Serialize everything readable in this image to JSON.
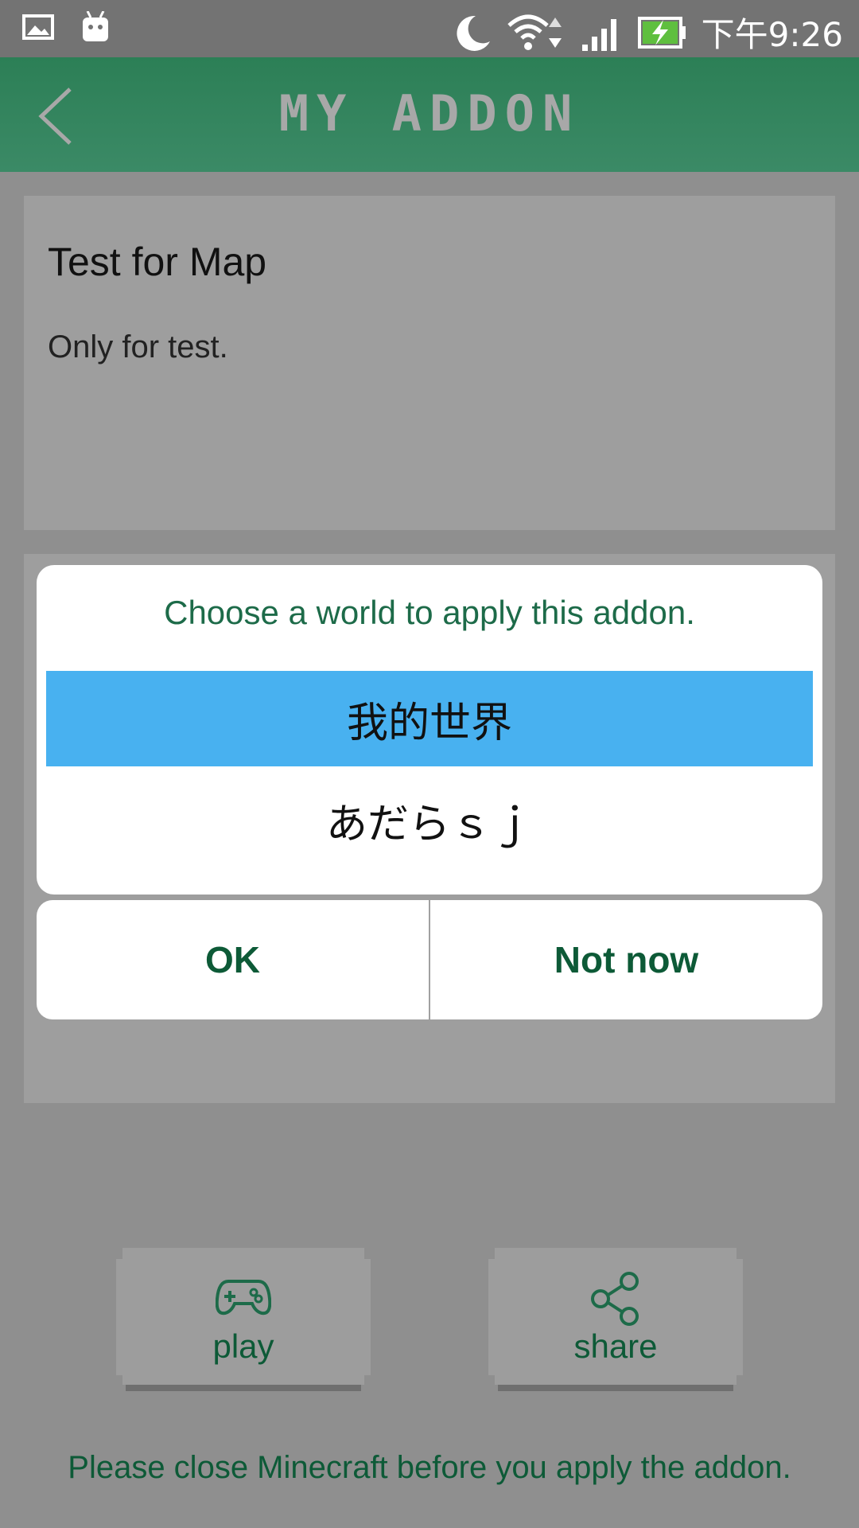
{
  "status_bar": {
    "time": "下午9:26",
    "icons": [
      "gallery-icon",
      "android-icon",
      "moon-icon",
      "wifi-icon",
      "signal-icon",
      "battery-charging-icon"
    ]
  },
  "app_bar": {
    "title": "MY ADDON",
    "back_icon": "chevron-left-icon"
  },
  "addon_card": {
    "title": "Test for Map",
    "description": "Only for test."
  },
  "dialog": {
    "title": "Choose a world to apply this addon.",
    "worlds": [
      {
        "name": "我的世界",
        "selected": true
      },
      {
        "name": "あだらｓｊ",
        "selected": false
      }
    ],
    "ok_label": "OK",
    "not_now_label": "Not now"
  },
  "actions": {
    "play_label": "play",
    "play_icon": "gamepad-icon",
    "share_label": "share",
    "share_icon": "share-icon"
  },
  "footer_note": "Please close Minecraft before you apply the addon.",
  "colors": {
    "app_bar": "#2c7f56",
    "accent_text": "#0d5a37",
    "selected_item": "#48b1f0",
    "scrim": "#8f8f8f"
  }
}
